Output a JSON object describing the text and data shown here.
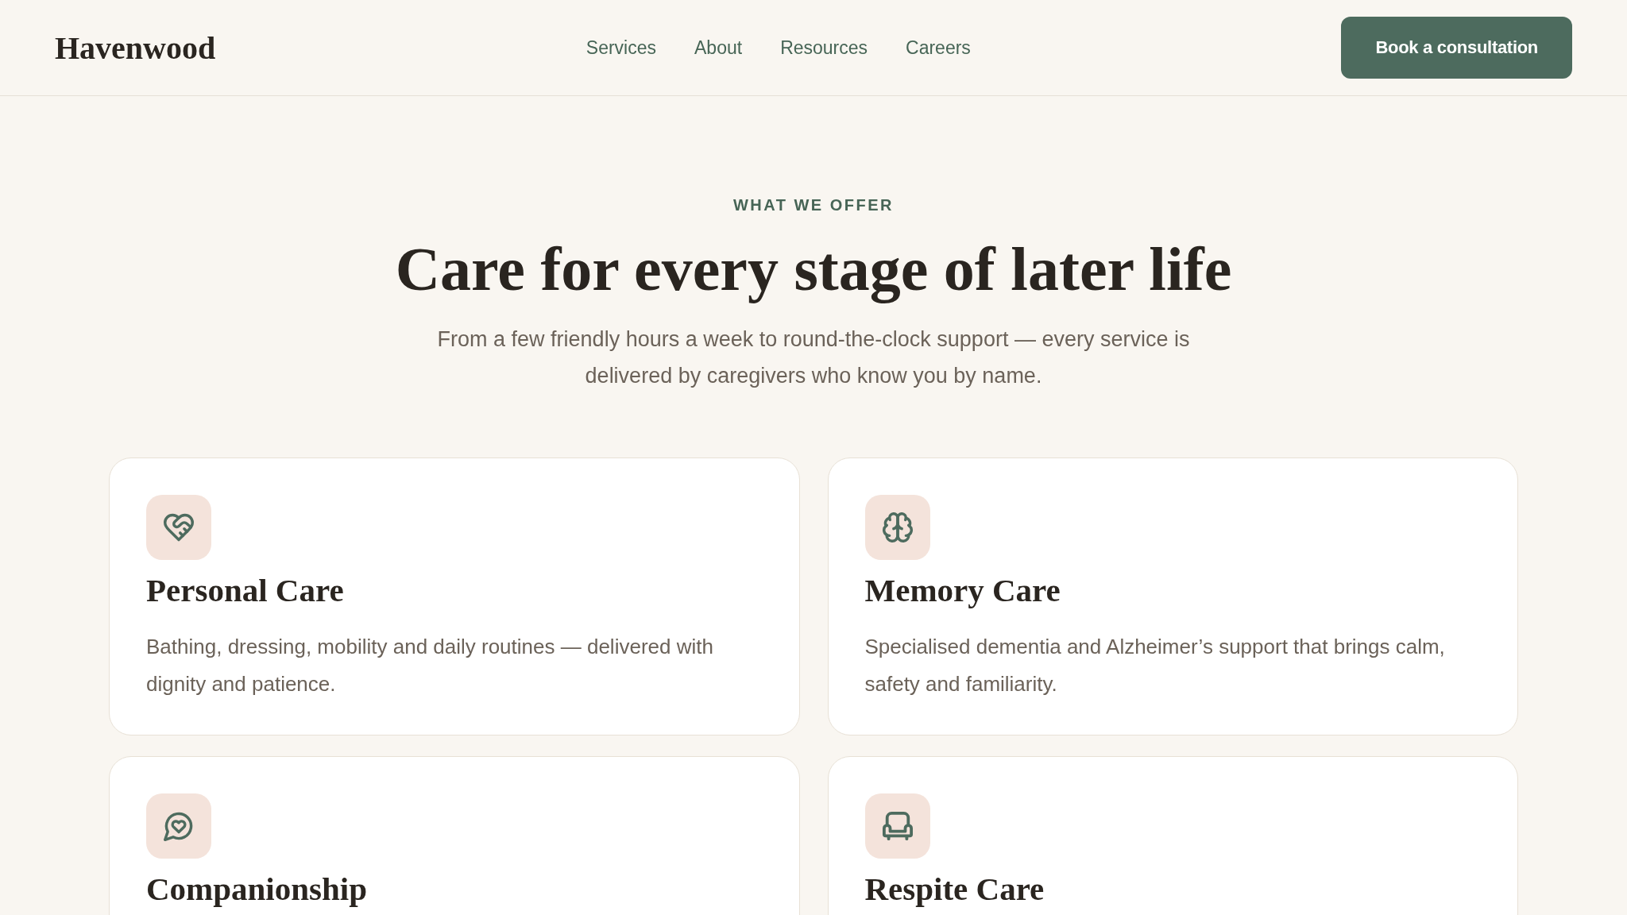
{
  "header": {
    "logo": "Havenwood",
    "nav": [
      "Services",
      "About",
      "Resources",
      "Careers"
    ],
    "cta_button": "Book a consultation"
  },
  "section": {
    "eyebrow": "WHAT WE OFFER",
    "title": "Care for every stage of later life",
    "subtitle": "From a few friendly hours a week to round-the-clock support — every service is delivered by caregivers who know you by name."
  },
  "cards": [
    {
      "title": "Personal Care",
      "description": "Bathing, dressing, mobility and daily routines — delivered with dignity and patience."
    },
    {
      "title": "Memory Care",
      "description": "Specialised dementia and Alzheimer’s support that brings calm, safety and familiarity."
    },
    {
      "title": "Companionship"
    },
    {
      "title": "Respite Care"
    }
  ]
}
